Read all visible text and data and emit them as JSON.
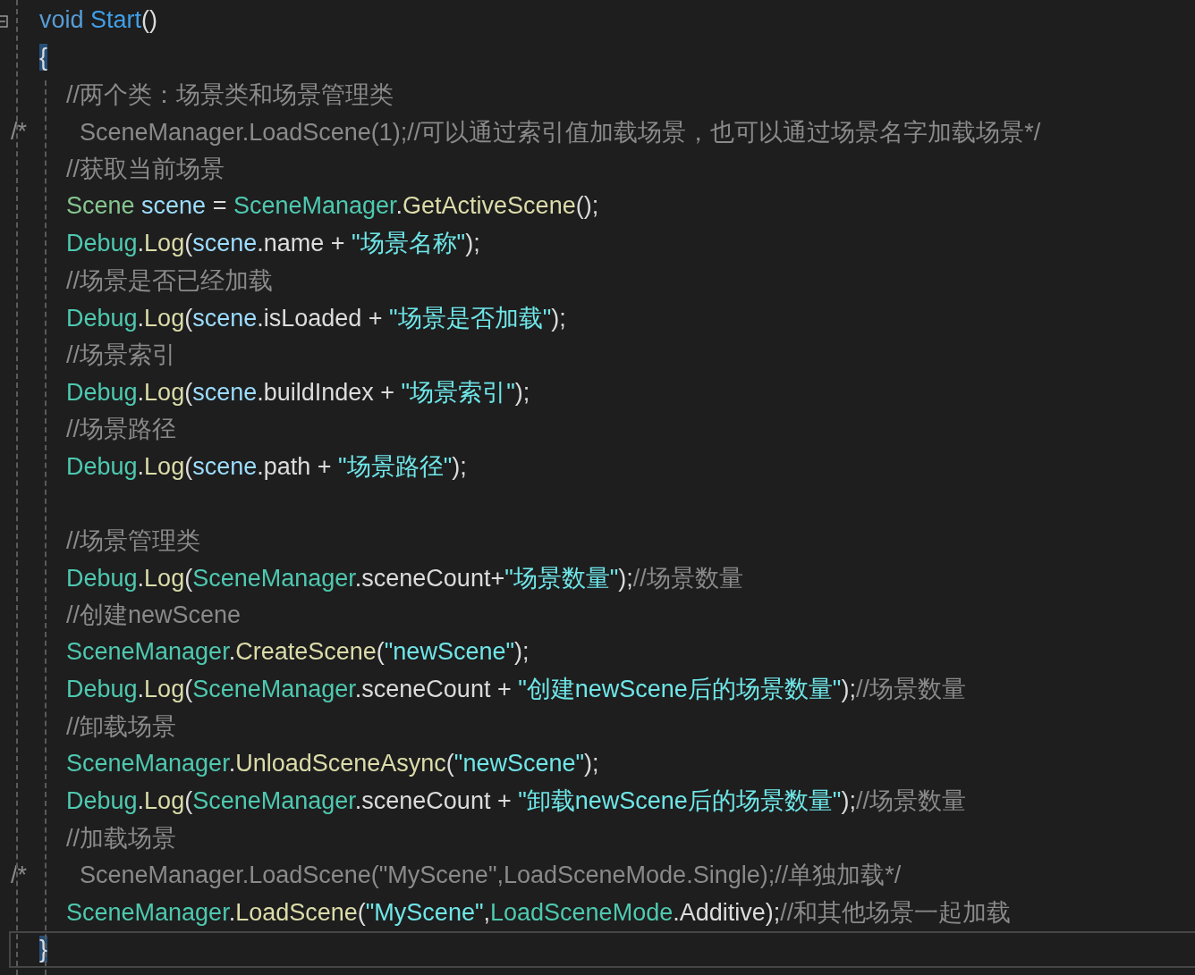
{
  "editor": {
    "lines": [
      {
        "kind": "code",
        "current": false,
        "tokens": [
          {
            "text": "void ",
            "kind": "keyword"
          },
          {
            "text": "Start",
            "kind": "method_decl"
          },
          {
            "text": "()",
            "kind": "plain"
          }
        ]
      },
      {
        "kind": "code",
        "current": false,
        "tokens": [
          {
            "text": "{",
            "kind": "brace_match"
          }
        ],
        "children": [
          {
            "kind": "code",
            "tokens": [
              {
                "text": "//两个类：场景类和场景管理类",
                "kind": "comment"
              }
            ]
          },
          {
            "kind": "code",
            "margin": "/*",
            "tokens": [
              {
                "text": "  SceneManager.LoadScene(1);//可以通过索引值加载场景，也可以通过场景名字加载场景*/",
                "kind": "comment"
              }
            ]
          },
          {
            "kind": "code",
            "tokens": [
              {
                "text": "//获取当前场景",
                "kind": "comment"
              }
            ]
          },
          {
            "kind": "code",
            "tokens": [
              {
                "text": "Scene ",
                "kind": "struct"
              },
              {
                "text": "scene",
                "kind": "variable"
              },
              {
                "text": " = ",
                "kind": "plain"
              },
              {
                "text": "SceneManager",
                "kind": "class"
              },
              {
                "text": ".",
                "kind": "plain"
              },
              {
                "text": "GetActiveScene",
                "kind": "method"
              },
              {
                "text": "();",
                "kind": "plain"
              }
            ]
          },
          {
            "kind": "code",
            "tokens": [
              {
                "text": "Debug",
                "kind": "class"
              },
              {
                "text": ".",
                "kind": "plain"
              },
              {
                "text": "Log",
                "kind": "method"
              },
              {
                "text": "(",
                "kind": "plain"
              },
              {
                "text": "scene",
                "kind": "variable"
              },
              {
                "text": ".name + ",
                "kind": "plain"
              },
              {
                "text": "\"场景名称\"",
                "kind": "string"
              },
              {
                "text": ");",
                "kind": "plain"
              }
            ]
          },
          {
            "kind": "code",
            "tokens": [
              {
                "text": "//场景是否已经加载",
                "kind": "comment"
              }
            ]
          },
          {
            "kind": "code",
            "tokens": [
              {
                "text": "Debug",
                "kind": "class"
              },
              {
                "text": ".",
                "kind": "plain"
              },
              {
                "text": "Log",
                "kind": "method"
              },
              {
                "text": "(",
                "kind": "plain"
              },
              {
                "text": "scene",
                "kind": "variable"
              },
              {
                "text": ".isLoaded + ",
                "kind": "plain"
              },
              {
                "text": "\"场景是否加载\"",
                "kind": "string"
              },
              {
                "text": ");",
                "kind": "plain"
              }
            ]
          },
          {
            "kind": "code",
            "tokens": [
              {
                "text": "//场景索引",
                "kind": "comment"
              }
            ]
          },
          {
            "kind": "code",
            "tokens": [
              {
                "text": "Debug",
                "kind": "class"
              },
              {
                "text": ".",
                "kind": "plain"
              },
              {
                "text": "Log",
                "kind": "method"
              },
              {
                "text": "(",
                "kind": "plain"
              },
              {
                "text": "scene",
                "kind": "variable"
              },
              {
                "text": ".buildIndex + ",
                "kind": "plain"
              },
              {
                "text": "\"场景索引\"",
                "kind": "string"
              },
              {
                "text": ");",
                "kind": "plain"
              }
            ]
          },
          {
            "kind": "code",
            "tokens": [
              {
                "text": "//场景路径",
                "kind": "comment"
              }
            ]
          },
          {
            "kind": "code",
            "tokens": [
              {
                "text": "Debug",
                "kind": "class"
              },
              {
                "text": ".",
                "kind": "plain"
              },
              {
                "text": "Log",
                "kind": "method"
              },
              {
                "text": "(",
                "kind": "plain"
              },
              {
                "text": "scene",
                "kind": "variable"
              },
              {
                "text": ".path + ",
                "kind": "plain"
              },
              {
                "text": "\"场景路径\"",
                "kind": "string"
              },
              {
                "text": ");",
                "kind": "plain"
              }
            ]
          },
          {
            "kind": "blank"
          },
          {
            "kind": "code",
            "tokens": [
              {
                "text": "//场景管理类",
                "kind": "comment"
              }
            ]
          },
          {
            "kind": "code",
            "tokens": [
              {
                "text": "Debug",
                "kind": "class"
              },
              {
                "text": ".",
                "kind": "plain"
              },
              {
                "text": "Log",
                "kind": "method"
              },
              {
                "text": "(",
                "kind": "plain"
              },
              {
                "text": "SceneManager",
                "kind": "class"
              },
              {
                "text": ".sceneCount+",
                "kind": "plain"
              },
              {
                "text": "\"场景数量\"",
                "kind": "string"
              },
              {
                "text": ");",
                "kind": "plain"
              },
              {
                "text": "//场景数量",
                "kind": "comment"
              }
            ]
          },
          {
            "kind": "code",
            "tokens": [
              {
                "text": "//创建newScene",
                "kind": "comment"
              }
            ]
          },
          {
            "kind": "code",
            "tokens": [
              {
                "text": "SceneManager",
                "kind": "class"
              },
              {
                "text": ".",
                "kind": "plain"
              },
              {
                "text": "CreateScene",
                "kind": "method"
              },
              {
                "text": "(",
                "kind": "plain"
              },
              {
                "text": "\"newScene\"",
                "kind": "string"
              },
              {
                "text": ");",
                "kind": "plain"
              }
            ]
          },
          {
            "kind": "code",
            "tokens": [
              {
                "text": "Debug",
                "kind": "class"
              },
              {
                "text": ".",
                "kind": "plain"
              },
              {
                "text": "Log",
                "kind": "method"
              },
              {
                "text": "(",
                "kind": "plain"
              },
              {
                "text": "SceneManager",
                "kind": "class"
              },
              {
                "text": ".sceneCount + ",
                "kind": "plain"
              },
              {
                "text": "\"创建newScene后的场景数量\"",
                "kind": "string"
              },
              {
                "text": ");",
                "kind": "plain"
              },
              {
                "text": "//场景数量",
                "kind": "comment"
              }
            ]
          },
          {
            "kind": "code",
            "tokens": [
              {
                "text": "//卸载场景",
                "kind": "comment"
              }
            ]
          },
          {
            "kind": "code",
            "tokens": [
              {
                "text": "SceneManager",
                "kind": "class"
              },
              {
                "text": ".",
                "kind": "plain"
              },
              {
                "text": "UnloadSceneAsync",
                "kind": "method"
              },
              {
                "text": "(",
                "kind": "plain"
              },
              {
                "text": "\"newScene\"",
                "kind": "string"
              },
              {
                "text": ");",
                "kind": "plain"
              }
            ]
          },
          {
            "kind": "code",
            "tokens": [
              {
                "text": "Debug",
                "kind": "class"
              },
              {
                "text": ".",
                "kind": "plain"
              },
              {
                "text": "Log",
                "kind": "method"
              },
              {
                "text": "(",
                "kind": "plain"
              },
              {
                "text": "SceneManager",
                "kind": "class"
              },
              {
                "text": ".sceneCount + ",
                "kind": "plain"
              },
              {
                "text": "\"卸载newScene后的场景数量\"",
                "kind": "string"
              },
              {
                "text": ");",
                "kind": "plain"
              },
              {
                "text": "//场景数量",
                "kind": "comment"
              }
            ]
          },
          {
            "kind": "code",
            "tokens": [
              {
                "text": "//加载场景",
                "kind": "comment"
              }
            ]
          },
          {
            "kind": "code",
            "margin": "/*",
            "tokens": [
              {
                "text": "  SceneManager.LoadScene(\"MyScene\",LoadSceneMode.Single);//单独加载*/",
                "kind": "comment"
              }
            ]
          },
          {
            "kind": "code",
            "tokens": [
              {
                "text": "SceneManager",
                "kind": "class"
              },
              {
                "text": ".",
                "kind": "plain"
              },
              {
                "text": "LoadScene",
                "kind": "method"
              },
              {
                "text": "(",
                "kind": "plain"
              },
              {
                "text": "\"MyScene\"",
                "kind": "string"
              },
              {
                "text": ",",
                "kind": "plain"
              },
              {
                "text": "LoadSceneMode",
                "kind": "class"
              },
              {
                "text": ".Additive);",
                "kind": "plain"
              },
              {
                "text": "//和其他场景一起加载",
                "kind": "comment"
              }
            ]
          }
        ]
      },
      {
        "kind": "code",
        "current": true,
        "tokens": [
          {
            "text": "}",
            "kind": "brace_match"
          }
        ]
      }
    ]
  }
}
